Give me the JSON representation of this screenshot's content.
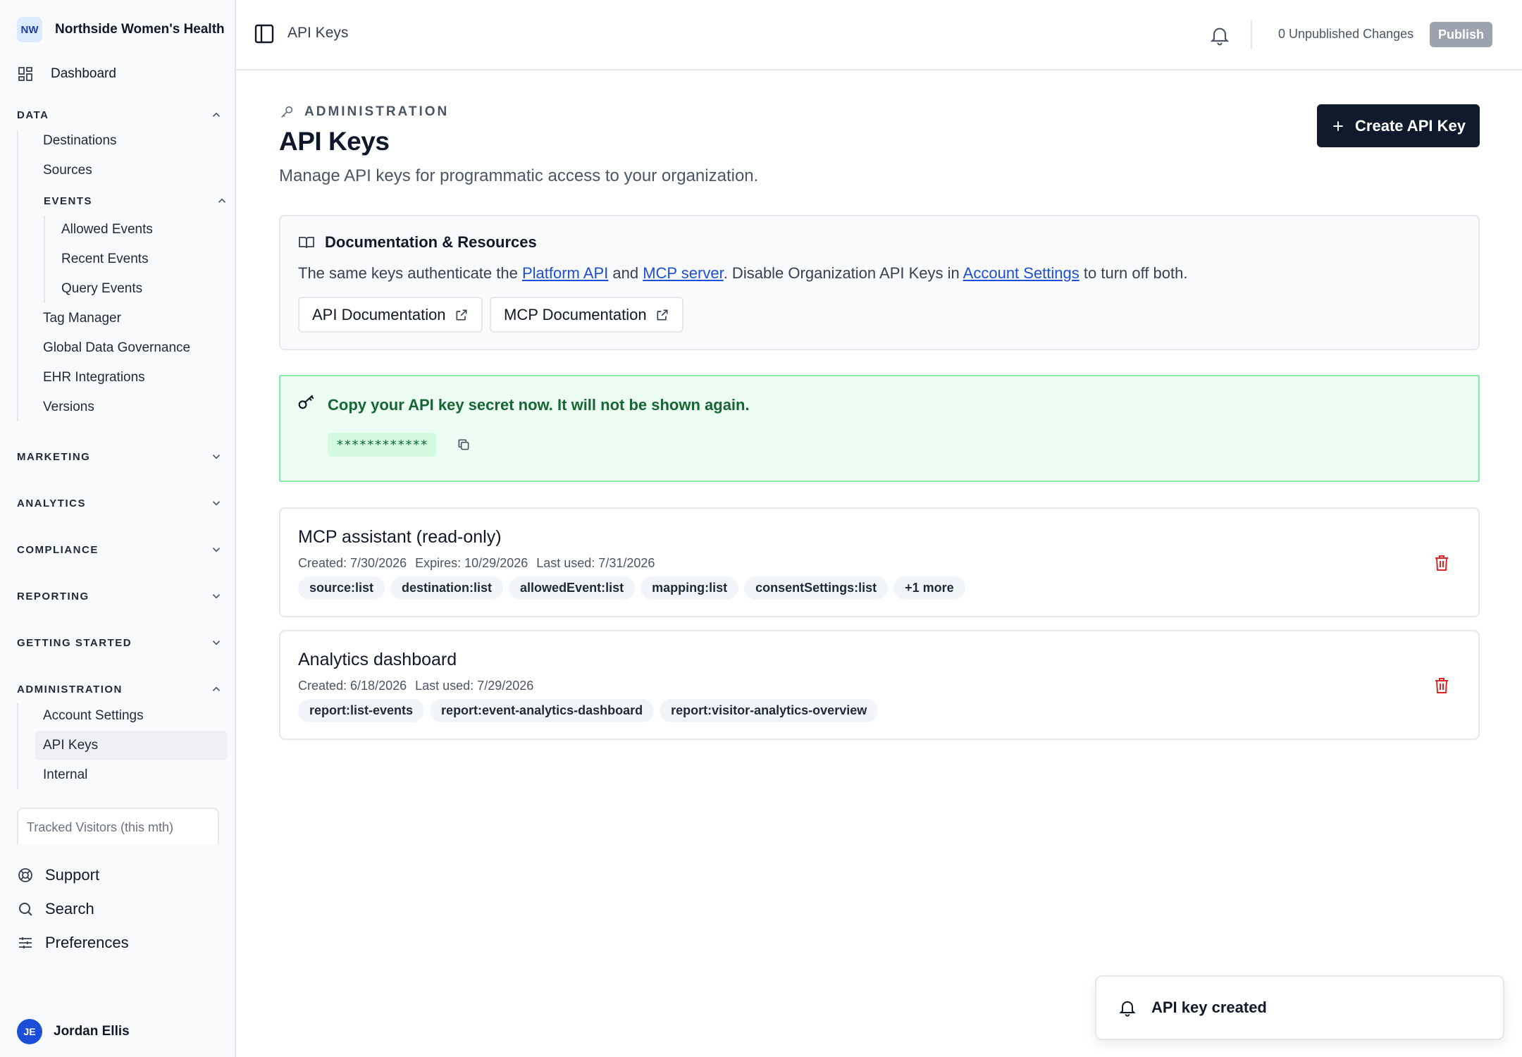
{
  "org": {
    "initials": "NW",
    "name": "Northside Women's Health"
  },
  "nav": {
    "dashboard": "Dashboard",
    "data": {
      "title": "DATA",
      "items": [
        "Destinations",
        "Sources"
      ],
      "events": {
        "title": "EVENTS",
        "items": [
          "Allowed Events",
          "Recent Events",
          "Query Events"
        ]
      },
      "more_items": [
        "Tag Manager",
        "Global Data Governance",
        "EHR Integrations",
        "Versions"
      ]
    },
    "collapsed_sections": [
      "MARKETING",
      "ANALYTICS",
      "COMPLIANCE",
      "REPORTING",
      "GETTING STARTED"
    ],
    "administration": {
      "title": "ADMINISTRATION",
      "items": [
        "Account Settings",
        "API Keys",
        "Internal"
      ],
      "active": "API Keys"
    }
  },
  "tracked_visitors_label": "Tracked Visitors (this mth)",
  "utilities": {
    "support": "Support",
    "search": "Search",
    "preferences": "Preferences"
  },
  "user": {
    "initials": "JE",
    "name": "Jordan Ellis"
  },
  "topbar": {
    "breadcrumb": "API Keys",
    "unpublished": "0 Unpublished Changes",
    "publish": "Publish"
  },
  "page": {
    "eyebrow": "ADMINISTRATION",
    "title": "API Keys",
    "subtitle": "Manage API keys for programmatic access to your organization.",
    "create_button": "Create API Key"
  },
  "docs": {
    "title": "Documentation & Resources",
    "text_1": "The same keys authenticate the ",
    "link_platform": "Platform API",
    "text_2": " and ",
    "link_mcp": "MCP server",
    "text_3": ". Disable Organization API Keys in ",
    "link_account": "Account Settings",
    "text_4": " to turn off both.",
    "api_doc_button": "API Documentation",
    "mcp_doc_button": "MCP Documentation"
  },
  "secret": {
    "message": "Copy your API key secret now. It will not be shown again.",
    "value": "************"
  },
  "keys": [
    {
      "name": "MCP assistant (read-only)",
      "created": "Created: 7/30/2026",
      "expires": "Expires: 10/29/2026",
      "last_used": "Last used: 7/31/2026",
      "scopes": [
        "source:list",
        "destination:list",
        "allowedEvent:list",
        "mapping:list",
        "consentSettings:list",
        "+1 more"
      ]
    },
    {
      "name": "Analytics dashboard",
      "created": "Created: 6/18/2026",
      "last_used": "Last used: 7/29/2026",
      "scopes": [
        "report:list-events",
        "report:event-analytics-dashboard",
        "report:visitor-analytics-overview"
      ]
    }
  ],
  "toast": {
    "message": "API key created"
  }
}
